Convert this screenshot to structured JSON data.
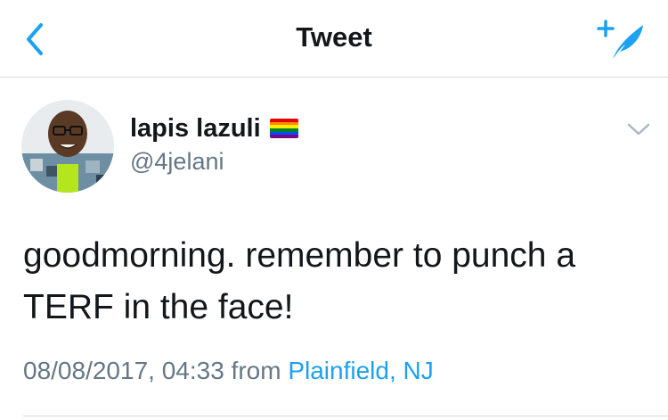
{
  "nav": {
    "title": "Tweet",
    "back_icon": "chevron-left-icon",
    "compose_icon": "compose-quill-icon"
  },
  "tweet": {
    "display_name": "lapis lazuli",
    "handle": "@4jelani",
    "text": "goodmorning. remember to punch a TERF in the face!",
    "timestamp": "08/08/2017, 04:33",
    "from_label": "from",
    "location": "Plainfield, NJ"
  },
  "colors": {
    "accent": "#1da1f2",
    "secondary_text": "#657786",
    "primary_text": "#14171a",
    "divider": "#d6d9dc"
  },
  "emoji": {
    "rainbow_flag": [
      "#e40303",
      "#ff8c00",
      "#ffed00",
      "#008026",
      "#004dff",
      "#750787"
    ]
  }
}
